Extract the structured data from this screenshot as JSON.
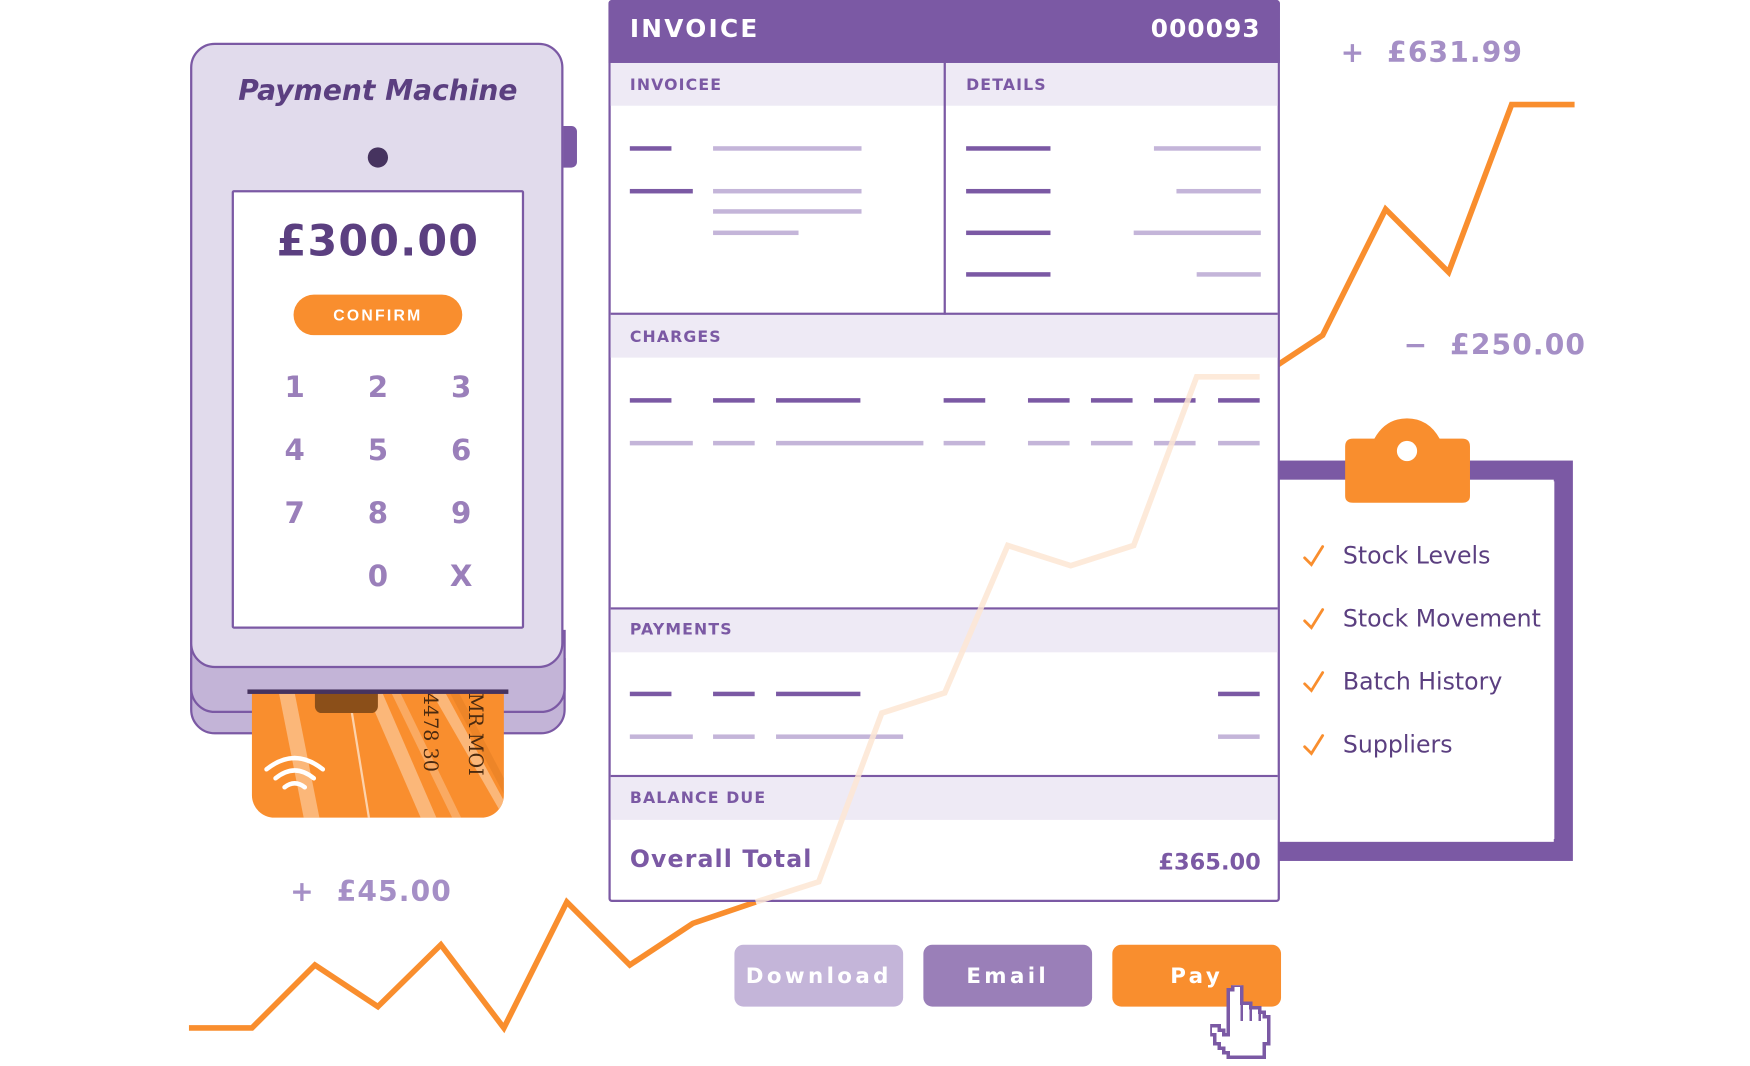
{
  "payment_machine": {
    "title": "Payment Machine",
    "amount": "£300.00",
    "confirm_label": "CONFIRM",
    "keypad": [
      "1",
      "2",
      "3",
      "4",
      "5",
      "6",
      "7",
      "8",
      "9",
      "0",
      "X"
    ],
    "card": {
      "number_fragment": "4478 30",
      "name_fragment": "MR MOI"
    }
  },
  "invoice": {
    "title": "INVOICE",
    "number": "000093",
    "sections": {
      "invoicee": "INVOICEE",
      "details": "DETAILS",
      "charges": "CHARGES",
      "payments": "PAYMENTS",
      "balance_due": "BALANCE DUE"
    },
    "total_label": "Overall Total",
    "total_value": "£365.00"
  },
  "actions": {
    "download_label": "Download",
    "email_label": "Email",
    "pay_label": "Pay"
  },
  "transactions": [
    {
      "sign": "+",
      "amount": "£631.99"
    },
    {
      "sign": "−",
      "amount": "£250.00"
    },
    {
      "sign": "+",
      "amount": "£45.00"
    }
  ],
  "clipboard": {
    "items": [
      {
        "label": "Stock Levels",
        "checked": true
      },
      {
        "label": "Stock Movement",
        "checked": true
      },
      {
        "label": "Batch History",
        "checked": true
      },
      {
        "label": "Suppliers",
        "checked": true
      }
    ]
  },
  "colors": {
    "primary_purple": "#7b59a4",
    "dark_purple": "#5b3f80",
    "light_purple": "#c4b5d9",
    "accent_orange": "#f98e2e"
  }
}
